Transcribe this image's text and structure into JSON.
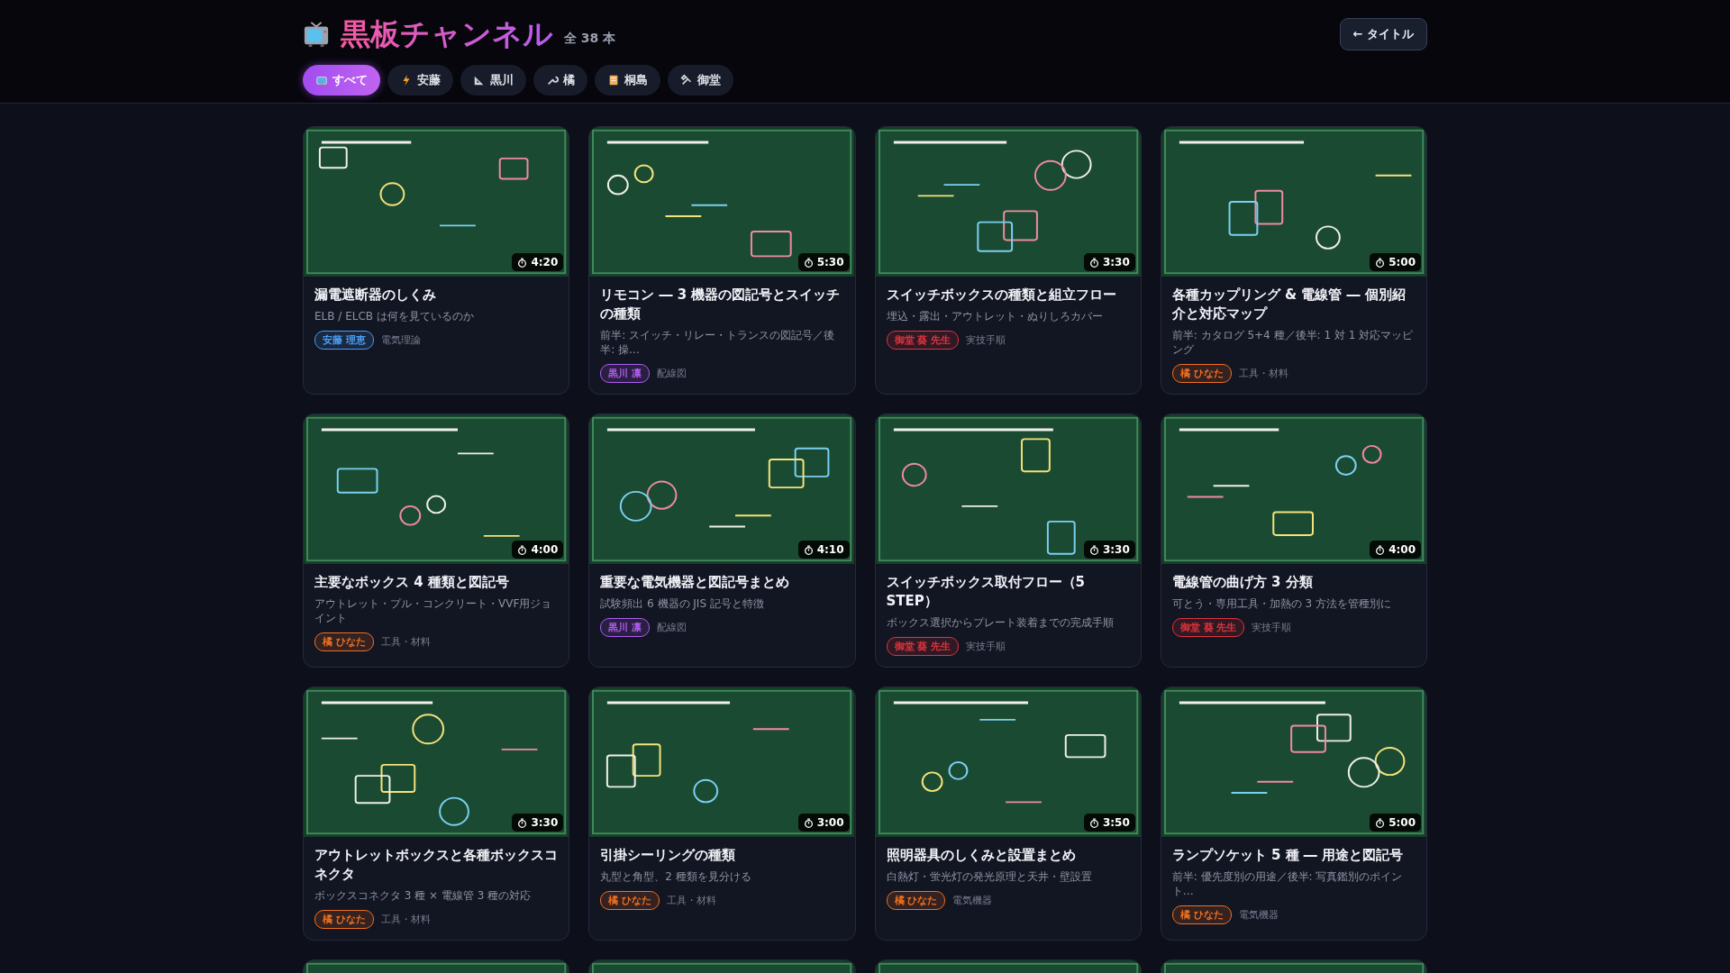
{
  "header": {
    "title": "黒板チャンネル",
    "count": "全 38 本",
    "back_button": "← タイトル"
  },
  "filters": [
    {
      "label": "すべて",
      "selected": true
    },
    {
      "label": "安藤",
      "selected": false
    },
    {
      "label": "黒川",
      "selected": false
    },
    {
      "label": "橘",
      "selected": false
    },
    {
      "label": "桐島",
      "selected": false
    },
    {
      "label": "御堂",
      "selected": false
    }
  ],
  "cards": [
    {
      "thumbnail": {
        "kind": "picture"
      },
      "duration": "4:20",
      "title": "漏電遮断器のしくみ",
      "subtitle": "ELB / ELCB は何を見ているのか",
      "author": {
        "name": "安藤 理恵",
        "color": "#4a9cf0"
      },
      "category": "電気理論"
    },
    {
      "thumbnail": {
        "kind": "picture"
      },
      "duration": "5:30",
      "title": "リモコン ― 3 機器の図記号とスイッチの種類",
      "subtitle": "前半: スイッチ・リレー・トランスの図記号／後半: 操…",
      "author": {
        "name": "黒川 凛",
        "color": "#b05cf0"
      },
      "category": "配線図"
    },
    {
      "thumbnail": {
        "kind": "picture"
      },
      "duration": "3:30",
      "title": "スイッチボックスの種類と組立フロー",
      "subtitle": "埋込・露出・アウトレット・ぬりしろカバー",
      "author": {
        "name": "御堂 葵 先生",
        "color": "#e0343c"
      },
      "category": "実技手順"
    },
    {
      "thumbnail": {
        "kind": "picture"
      },
      "duration": "5:00",
      "title": "各種カップリング & 電線管 ― 個別紹介と対応マップ",
      "subtitle": "前半: カタログ 5+4 種／後半: 1 対 1 対応マッピング",
      "author": {
        "name": "橘 ひなた",
        "color": "#f07020"
      },
      "category": "工具・材料"
    },
    {
      "thumbnail": {
        "kind": "picture"
      },
      "duration": "4:00",
      "title": "主要なボックス 4 種類と図記号",
      "subtitle": "アウトレット・プル・コンクリート・VVF用ジョイント",
      "author": {
        "name": "橘 ひなた",
        "color": "#f07020"
      },
      "category": "工具・材料"
    },
    {
      "thumbnail": {
        "kind": "picture"
      },
      "duration": "4:10",
      "title": "重要な電気機器と図記号まとめ",
      "subtitle": "試験頻出 6 機器の JIS 記号と特徴",
      "author": {
        "name": "黒川 凛",
        "color": "#b05cf0"
      },
      "category": "配線図"
    },
    {
      "thumbnail": {
        "kind": "picture"
      },
      "duration": "3:30",
      "title": "スイッチボックス取付フロー（5 STEP）",
      "subtitle": "ボックス選択からプレート装着までの完成手順",
      "author": {
        "name": "御堂 葵 先生",
        "color": "#e0343c"
      },
      "category": "実技手順"
    },
    {
      "thumbnail": {
        "kind": "picture"
      },
      "duration": "4:00",
      "title": "電線管の曲げ方 3 分類",
      "subtitle": "可とう・専用工具・加熱の 3 方法を管種別に",
      "author": {
        "name": "御堂 葵 先生",
        "color": "#e0343c"
      },
      "category": "実技手順"
    },
    {
      "thumbnail": {
        "kind": "picture"
      },
      "duration": "3:30",
      "title": "アウトレットボックスと各種ボックスコネクタ",
      "subtitle": "ボックスコネクタ 3 種 × 電線管 3 種の対応",
      "author": {
        "name": "橘 ひなた",
        "color": "#f07020"
      },
      "category": "工具・材料"
    },
    {
      "thumbnail": {
        "kind": "picture"
      },
      "duration": "3:00",
      "title": "引掛シーリングの種類",
      "subtitle": "丸型と角型、2 種類を見分ける",
      "author": {
        "name": "橘 ひなた",
        "color": "#f07020"
      },
      "category": "工具・材料"
    },
    {
      "thumbnail": {
        "kind": "picture"
      },
      "duration": "3:50",
      "title": "照明器具のしくみと設置まとめ",
      "subtitle": "白熱灯・蛍光灯の発光原理と天井・壁設置",
      "author": {
        "name": "橘 ひなた",
        "color": "#f07020"
      },
      "category": "電気機器"
    },
    {
      "thumbnail": {
        "kind": "picture"
      },
      "duration": "5:00",
      "title": "ランプソケット 5 種 ― 用途と図記号",
      "subtitle": "前半: 優先度別の用途／後半: 写真鑑別のポイント…",
      "author": {
        "name": "橘 ひなた",
        "color": "#f07020"
      },
      "category": "電気機器"
    },
    {
      "thumbnail": {
        "kind": "picture"
      }
    },
    {
      "thumbnail": {
        "kind": "picture"
      }
    },
    {
      "thumbnail": {
        "kind": "picture"
      }
    },
    {
      "thumbnail": {
        "kind": "picture"
      }
    }
  ]
}
